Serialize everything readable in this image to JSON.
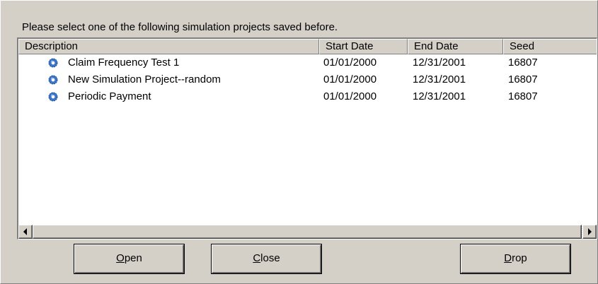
{
  "dialog": {
    "prompt": "Please select one of the following simulation projects saved before."
  },
  "list": {
    "columns": {
      "description": "Description",
      "start_date": "Start Date",
      "end_date": "End Date",
      "seed": "Seed"
    },
    "rows": [
      {
        "icon": "gear-icon",
        "description": "Claim Frequency Test 1",
        "start_date": "01/01/2000",
        "end_date": "12/31/2001",
        "seed": "16807"
      },
      {
        "icon": "gear-icon",
        "description": "New Simulation Project--random",
        "start_date": "01/01/2000",
        "end_date": "12/31/2001",
        "seed": "16807"
      },
      {
        "icon": "gear-icon",
        "description": "Periodic Payment",
        "start_date": "01/01/2000",
        "end_date": "12/31/2001",
        "seed": "16807"
      }
    ]
  },
  "buttons": {
    "open": {
      "mnemonic": "O",
      "rest": "pen"
    },
    "close": {
      "mnemonic": "C",
      "rest": "lose"
    },
    "drop": {
      "mnemonic": "D",
      "rest": "rop"
    }
  },
  "colors": {
    "face": "#d4d0c8",
    "icon_blue": "#3b74c9"
  }
}
